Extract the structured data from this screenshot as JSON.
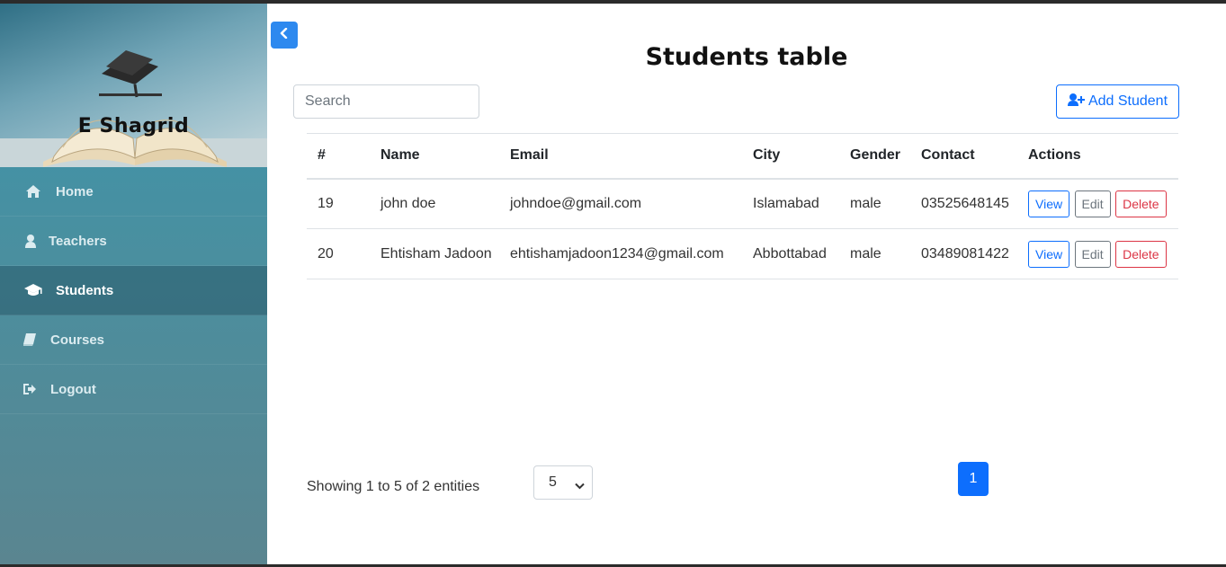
{
  "app": {
    "brand": "E Shagrid"
  },
  "sidebar": {
    "items": [
      {
        "label": "Home",
        "icon": "home-icon"
      },
      {
        "label": "Teachers",
        "icon": "user-icon"
      },
      {
        "label": "Students",
        "icon": "graduation-cap-icon",
        "active": true
      },
      {
        "label": "Courses",
        "icon": "book-icon"
      },
      {
        "label": "Logout",
        "icon": "sign-out-icon"
      }
    ]
  },
  "main": {
    "title": "Students table",
    "search": {
      "placeholder": "Search",
      "value": ""
    },
    "add_button": "Add Student",
    "table": {
      "headers": [
        "#",
        "Name",
        "Email",
        "City",
        "Gender",
        "Contact",
        "Actions"
      ],
      "rows": [
        {
          "id": "19",
          "name": "john doe",
          "email": "johndoe@gmail.com",
          "city": "Islamabad",
          "gender": "male",
          "contact": "03525648145"
        },
        {
          "id": "20",
          "name": "Ehtisham Jadoon",
          "email": "ehtishamjadoon1234@gmail.com",
          "city": "Abbottabad",
          "gender": "male",
          "contact": "03489081422"
        }
      ],
      "actions": {
        "view": "View",
        "edit": "Edit",
        "delete": "Delete"
      }
    },
    "footer": {
      "showing": "Showing 1 to 5 of 2 entities",
      "page_size": "5",
      "current_page": "1"
    }
  },
  "colors": {
    "primary": "#0d6efd",
    "danger": "#dc3545",
    "secondary": "#6c757d",
    "sidebar": "#3a95ad"
  }
}
